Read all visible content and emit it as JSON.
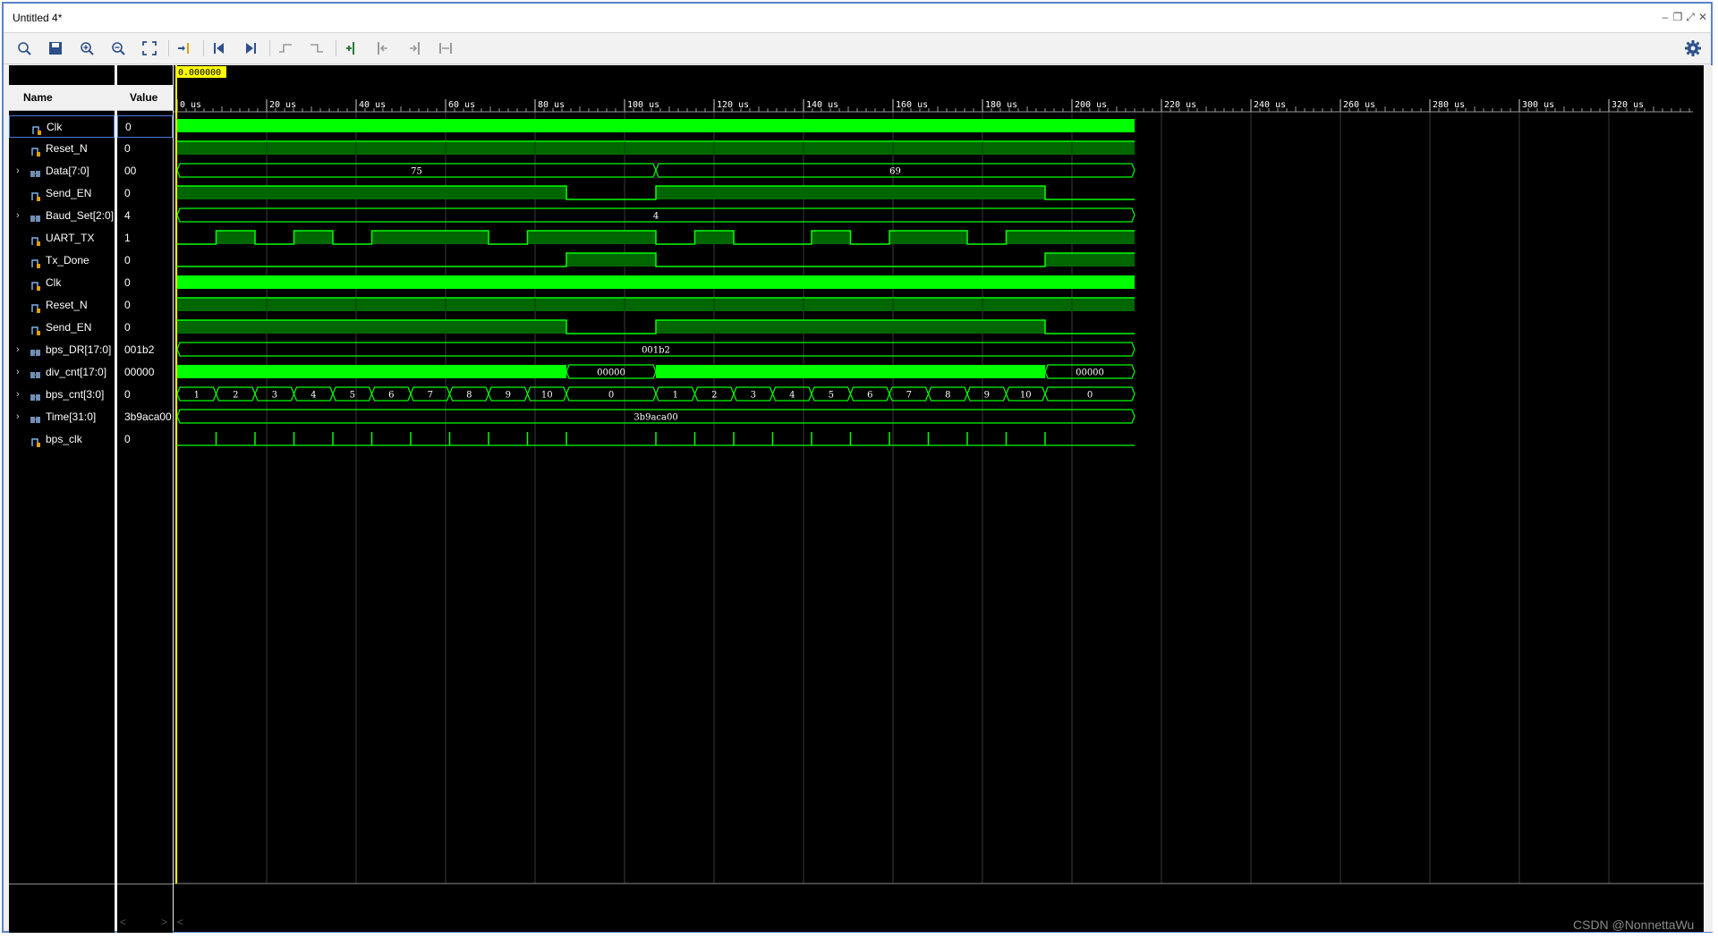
{
  "window": {
    "title": "Untitled 4*"
  },
  "toolbar": {
    "buttons": [
      {
        "name": "search-icon"
      },
      {
        "name": "save-icon"
      },
      {
        "name": "zoom-in-icon"
      },
      {
        "name": "zoom-out-icon"
      },
      {
        "name": "zoom-fit-icon"
      },
      {
        "name": "go-to-cursor-icon"
      },
      {
        "name": "go-to-start-icon"
      },
      {
        "name": "go-to-end-icon"
      },
      {
        "name": "previous-transition-icon"
      },
      {
        "name": "next-transition-icon"
      },
      {
        "name": "add-marker-icon"
      },
      {
        "name": "previous-marker-icon"
      },
      {
        "name": "next-marker-icon"
      },
      {
        "name": "swap-cursors-icon"
      }
    ],
    "settings_icon": "gear-icon"
  },
  "columns": {
    "name_header": "Name",
    "value_header": "Value"
  },
  "cursor": {
    "label": "0.000000 us",
    "time_us": 0
  },
  "timeline": {
    "ticks": [
      "0 us",
      "20 us",
      "40 us",
      "60 us",
      "80 us",
      "100 us",
      "120 us",
      "140 us",
      "160 us",
      "180 us",
      "200 us",
      "220 us",
      "240 us",
      "260 us",
      "280 us",
      "300 us",
      "320 us"
    ],
    "max_us": 340,
    "sim_end_us": 214
  },
  "signals": [
    {
      "name": "Clk",
      "value": "0",
      "kind": "clk",
      "expandable": false
    },
    {
      "name": "Reset_N",
      "value": "0",
      "kind": "high",
      "expandable": false
    },
    {
      "name": "Data[7:0]",
      "value": "00",
      "kind": "bus",
      "expandable": true,
      "segments": [
        {
          "from": 0,
          "to": 107,
          "label": "75"
        },
        {
          "from": 107,
          "to": 214,
          "label": "69"
        }
      ]
    },
    {
      "name": "Send_EN",
      "value": "0",
      "kind": "bit",
      "transitions": [
        [
          0,
          1
        ],
        [
          87,
          0
        ],
        [
          107,
          1
        ],
        [
          194,
          0
        ]
      ]
    },
    {
      "name": "Baud_Set[2:0]",
      "value": "4",
      "kind": "bus",
      "expandable": true,
      "segments": [
        {
          "from": 0,
          "to": 214,
          "label": "4"
        }
      ]
    },
    {
      "name": "UART_TX",
      "value": "1",
      "kind": "bit",
      "transitions": [
        [
          0,
          0
        ],
        [
          8.7,
          1
        ],
        [
          17.4,
          0
        ],
        [
          26.1,
          1
        ],
        [
          34.8,
          0
        ],
        [
          43.5,
          1
        ],
        [
          69.6,
          0
        ],
        [
          78.3,
          1
        ],
        [
          107,
          0
        ],
        [
          115.7,
          1
        ],
        [
          124.4,
          0
        ],
        [
          141.8,
          1
        ],
        [
          150.5,
          0
        ],
        [
          159.2,
          1
        ],
        [
          176.6,
          0
        ],
        [
          185.3,
          1
        ]
      ]
    },
    {
      "name": "Tx_Done",
      "value": "0",
      "kind": "bit",
      "transitions": [
        [
          0,
          0
        ],
        [
          87,
          1
        ],
        [
          107,
          0
        ],
        [
          194,
          1
        ]
      ]
    },
    {
      "name": "Clk",
      "value": "0",
      "kind": "clk",
      "expandable": false
    },
    {
      "name": "Reset_N",
      "value": "0",
      "kind": "high",
      "expandable": false
    },
    {
      "name": "Send_EN",
      "value": "0",
      "kind": "bit",
      "transitions": [
        [
          0,
          1
        ],
        [
          87,
          0
        ],
        [
          107,
          1
        ],
        [
          194,
          0
        ]
      ]
    },
    {
      "name": "bps_DR[17:0]",
      "value": "001b2",
      "kind": "bus",
      "expandable": true,
      "segments": [
        {
          "from": 0,
          "to": 214,
          "label": "001b2"
        }
      ]
    },
    {
      "name": "div_cnt[17:0]",
      "value": "00000",
      "kind": "busdense",
      "expandable": true,
      "segments": [
        {
          "from": 0,
          "to": 87,
          "label": "",
          "dense": true
        },
        {
          "from": 87,
          "to": 107,
          "label": "00000"
        },
        {
          "from": 107,
          "to": 194,
          "label": "",
          "dense": true
        },
        {
          "from": 194,
          "to": 214,
          "label": "00000"
        }
      ]
    },
    {
      "name": "bps_cnt[3:0]",
      "value": "0",
      "kind": "bus",
      "expandable": true,
      "segments": [
        {
          "from": 0,
          "to": 8.7,
          "label": "1"
        },
        {
          "from": 8.7,
          "to": 17.4,
          "label": "2"
        },
        {
          "from": 17.4,
          "to": 26.1,
          "label": "3"
        },
        {
          "from": 26.1,
          "to": 34.8,
          "label": "4"
        },
        {
          "from": 34.8,
          "to": 43.5,
          "label": "5"
        },
        {
          "from": 43.5,
          "to": 52.2,
          "label": "6"
        },
        {
          "from": 52.2,
          "to": 60.9,
          "label": "7"
        },
        {
          "from": 60.9,
          "to": 69.6,
          "label": "8"
        },
        {
          "from": 69.6,
          "to": 78.3,
          "label": "9"
        },
        {
          "from": 78.3,
          "to": 87,
          "label": "10"
        },
        {
          "from": 87,
          "to": 107,
          "label": "0"
        },
        {
          "from": 107,
          "to": 115.7,
          "label": "1"
        },
        {
          "from": 115.7,
          "to": 124.4,
          "label": "2"
        },
        {
          "from": 124.4,
          "to": 133.1,
          "label": "3"
        },
        {
          "from": 133.1,
          "to": 141.8,
          "label": "4"
        },
        {
          "from": 141.8,
          "to": 150.5,
          "label": "5"
        },
        {
          "from": 150.5,
          "to": 159.2,
          "label": "6"
        },
        {
          "from": 159.2,
          "to": 167.9,
          "label": "7"
        },
        {
          "from": 167.9,
          "to": 176.6,
          "label": "8"
        },
        {
          "from": 176.6,
          "to": 185.3,
          "label": "9"
        },
        {
          "from": 185.3,
          "to": 194,
          "label": "10"
        },
        {
          "from": 194,
          "to": 214,
          "label": "0"
        }
      ]
    },
    {
      "name": "Time[31:0]",
      "value": "3b9aca00",
      "kind": "bus",
      "expandable": true,
      "segments": [
        {
          "from": 0,
          "to": 214,
          "label": "3b9aca00"
        }
      ]
    },
    {
      "name": "bps_clk",
      "value": "0",
      "kind": "pulse",
      "pulses": [
        8.7,
        17.4,
        26.1,
        34.8,
        43.5,
        52.2,
        60.9,
        69.6,
        78.3,
        87,
        107,
        115.7,
        124.4,
        133.1,
        141.8,
        150.5,
        159.2,
        167.9,
        176.6,
        185.3,
        194
      ]
    }
  ],
  "scroll": {
    "left_arrow": "<",
    "right_arrow": ">"
  },
  "watermark": "CSDN @NonnettaWu",
  "colors": {
    "wave": "#00ff00",
    "wave_dim": "#006600",
    "grid": "#3a3a3a",
    "cursor": "#ffff00",
    "bus_text": "#ffffff"
  }
}
